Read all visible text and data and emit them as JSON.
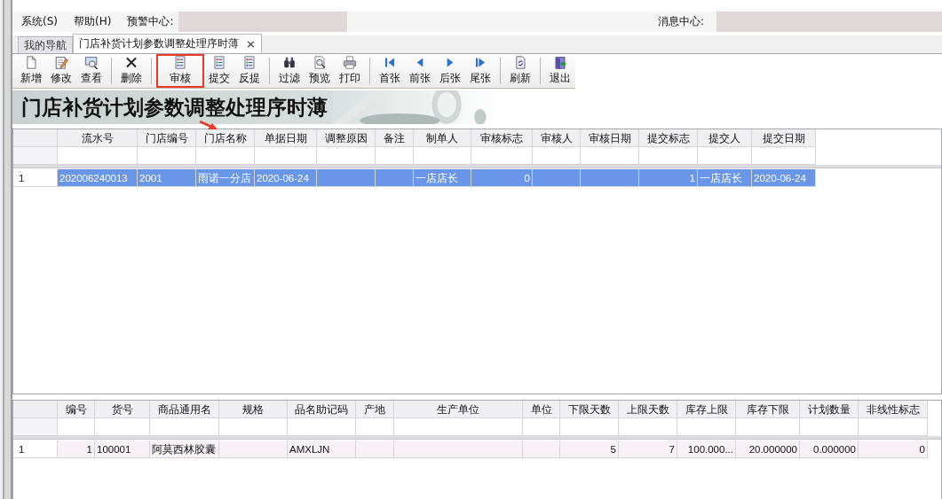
{
  "menu": {
    "items": [
      "系统(S)",
      "帮助(H)"
    ],
    "warning_label": "预警中心:",
    "message_label": "消息中心:"
  },
  "tabs": [
    {
      "label": "我的导航",
      "selected": false,
      "closable": false
    },
    {
      "label": "门店补货计划参数调整处理序时薄",
      "selected": true,
      "closable": true,
      "close": "×"
    }
  ],
  "toolbar": [
    [
      {
        "label": "新增",
        "kind": "document",
        "highlighted": false
      },
      {
        "label": "修改",
        "kind": "edit",
        "highlighted": false
      },
      {
        "label": "查看",
        "kind": "view",
        "highlighted": false
      }
    ],
    [
      {
        "label": "删除",
        "kind": "delete",
        "highlighted": false
      }
    ],
    [
      {
        "label": "审核",
        "kind": "list",
        "highlighted": true
      },
      {
        "label": "提交",
        "kind": "list",
        "highlighted": false
      },
      {
        "label": "反提",
        "kind": "list",
        "highlighted": false
      }
    ],
    [
      {
        "label": "过滤",
        "kind": "binoculars",
        "highlighted": false
      },
      {
        "label": "预览",
        "kind": "preview",
        "highlighted": false
      },
      {
        "label": "打印",
        "kind": "printer",
        "highlighted": false
      }
    ],
    [
      {
        "label": "首张",
        "kind": "first",
        "highlighted": false
      },
      {
        "label": "前张",
        "kind": "prev",
        "highlighted": false
      },
      {
        "label": "后张",
        "kind": "next",
        "highlighted": false
      },
      {
        "label": "尾张",
        "kind": "last",
        "highlighted": false
      }
    ],
    [
      {
        "label": "刷新",
        "kind": "refresh",
        "highlighted": false
      }
    ],
    [
      {
        "label": "退出",
        "kind": "exit",
        "highlighted": false
      }
    ]
  ],
  "banner": {
    "title": "门店补货计划参数调整处理序时薄",
    "kind": "picture"
  },
  "master_table": {
    "columns": [
      {
        "label": "流水号",
        "kind": "text"
      },
      {
        "label": "门店编号",
        "kind": "text"
      },
      {
        "label": "门店名称",
        "kind": "text"
      },
      {
        "label": "单据日期",
        "kind": "text"
      },
      {
        "label": "调整原因",
        "kind": "text"
      },
      {
        "label": "备注",
        "kind": "text"
      },
      {
        "label": "制单人",
        "kind": "text"
      },
      {
        "label": "审核标志",
        "kind": "number"
      },
      {
        "label": "审核人",
        "kind": "text"
      },
      {
        "label": "审核日期",
        "kind": "text"
      },
      {
        "label": "提交标志",
        "kind": "number"
      },
      {
        "label": "提交人",
        "kind": "text"
      },
      {
        "label": "提交日期",
        "kind": "text"
      }
    ],
    "rows": [
      {
        "number": "1",
        "selected": true,
        "cells": [
          "202006240013",
          "2001",
          "雨诺一分店",
          "2020-06-24",
          "",
          "",
          "一店店长",
          "0",
          "",
          "",
          "1",
          "一店店长",
          "2020-06-24"
        ]
      }
    ]
  },
  "detail_table": {
    "columns": [
      {
        "label": "编号",
        "kind": "number"
      },
      {
        "label": "货号",
        "kind": "text"
      },
      {
        "label": "商品通用名",
        "kind": "text"
      },
      {
        "label": "规格",
        "kind": "text"
      },
      {
        "label": "品名助记码",
        "kind": "text"
      },
      {
        "label": "产地",
        "kind": "text"
      },
      {
        "label": "生产单位",
        "kind": "text"
      },
      {
        "label": "单位",
        "kind": "text"
      },
      {
        "label": "下限天数",
        "kind": "number"
      },
      {
        "label": "上限天数",
        "kind": "number"
      },
      {
        "label": "库存上限",
        "kind": "number"
      },
      {
        "label": "库存下限",
        "kind": "number"
      },
      {
        "label": "计划数量",
        "kind": "number"
      },
      {
        "label": "非线性标志",
        "kind": "number"
      }
    ],
    "rows": [
      {
        "number": "1",
        "selected": false,
        "cells": [
          "1",
          "100001",
          "阿莫西林胶囊",
          "",
          "AMXLJN",
          "",
          "",
          "",
          "5",
          "7",
          "100.000...",
          "20.000000",
          "0.000000",
          "0"
        ]
      }
    ]
  }
}
